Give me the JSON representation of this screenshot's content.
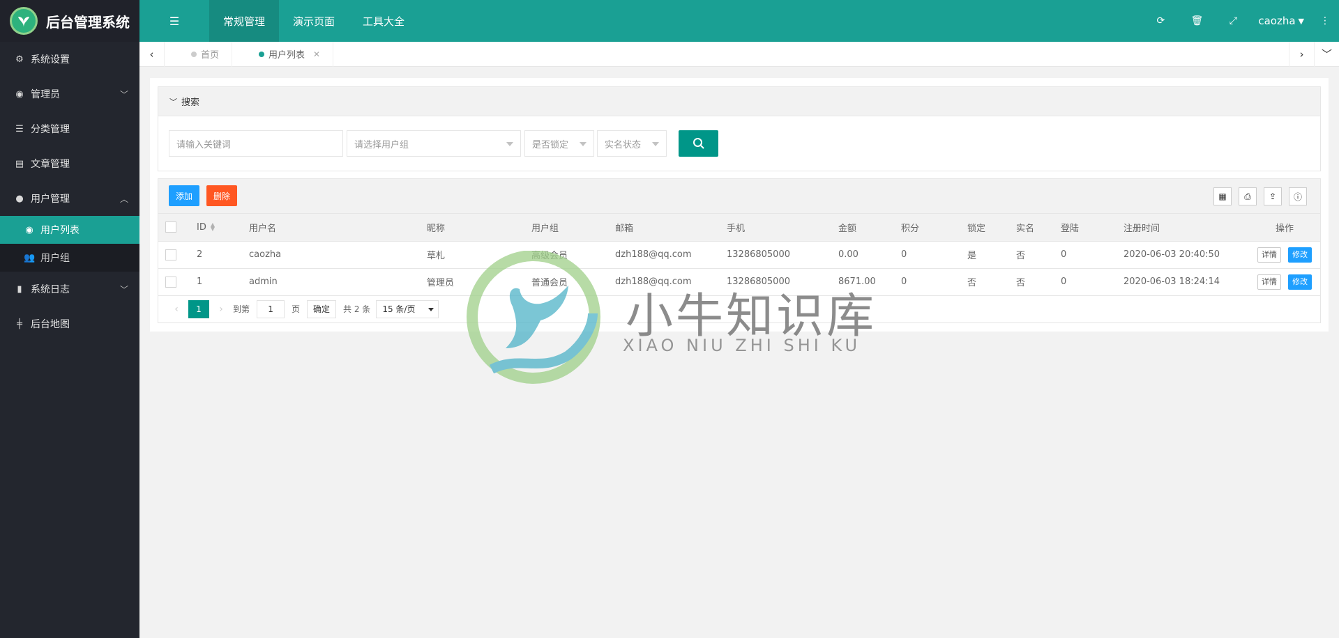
{
  "app": {
    "title": "后台管理系统"
  },
  "sidebar": {
    "items": [
      {
        "label": "系统设置",
        "icon": "gears-icon"
      },
      {
        "label": "管理员",
        "icon": "user-circle-icon"
      },
      {
        "label": "分类管理",
        "icon": "list-icon"
      },
      {
        "label": "文章管理",
        "icon": "newspaper-icon"
      },
      {
        "label": "用户管理",
        "icon": "user-icon"
      },
      {
        "label": "系统日志",
        "icon": "file-icon"
      },
      {
        "label": "后台地图",
        "icon": "signpost-icon"
      }
    ],
    "sub_items": [
      {
        "label": "用户列表",
        "icon": "user-circle-icon"
      },
      {
        "label": "用户组",
        "icon": "users-icon"
      }
    ]
  },
  "header": {
    "menus": [
      "常规管理",
      "演示页面",
      "工具大全"
    ],
    "user": "caozha"
  },
  "tabs": [
    {
      "label": "首页"
    },
    {
      "label": "用户列表"
    }
  ],
  "search": {
    "title": "搜索",
    "keyword_placeholder": "请输入关键词",
    "group_placeholder": "请选择用户组",
    "locked_placeholder": "是否锁定",
    "realname_placeholder": "实名状态"
  },
  "toolbar": {
    "add_label": "添加",
    "delete_label": "删除"
  },
  "table": {
    "headers": [
      "ID",
      "用户名",
      "昵称",
      "用户组",
      "邮箱",
      "手机",
      "金额",
      "积分",
      "锁定",
      "实名",
      "登陆",
      "注册时间",
      "操作"
    ],
    "rows": [
      {
        "id": "2",
        "username": "caozha",
        "nickname": "草札",
        "group": "高级会员",
        "email": "dzh188@qq.com",
        "phone": "13286805000",
        "amount": "0.00",
        "points": "0",
        "locked": "是",
        "realname": "否",
        "logins": "0",
        "reg_time": "2020-06-03 20:40:50"
      },
      {
        "id": "1",
        "username": "admin",
        "nickname": "管理员",
        "group": "普通会员",
        "email": "dzh188@qq.com",
        "phone": "13286805000",
        "amount": "8671.00",
        "points": "0",
        "locked": "否",
        "realname": "否",
        "logins": "0",
        "reg_time": "2020-06-03 18:24:14"
      }
    ],
    "detail_label": "详情",
    "edit_label": "修改"
  },
  "pager": {
    "current": "1",
    "goto_label": "到第",
    "goto_value": "1",
    "page_label": "页",
    "confirm_label": "确定",
    "total_label": "共 2 条",
    "per_page": "15 条/页"
  },
  "watermark": {
    "title": "小牛知识库",
    "subtitle": "XIAO NIU ZHI SHI KU"
  },
  "colors": {
    "sidebar": "#23262e",
    "header": "#1aa094",
    "primary": "#009688",
    "blue": "#1e9fff",
    "orange": "#ff5722"
  }
}
